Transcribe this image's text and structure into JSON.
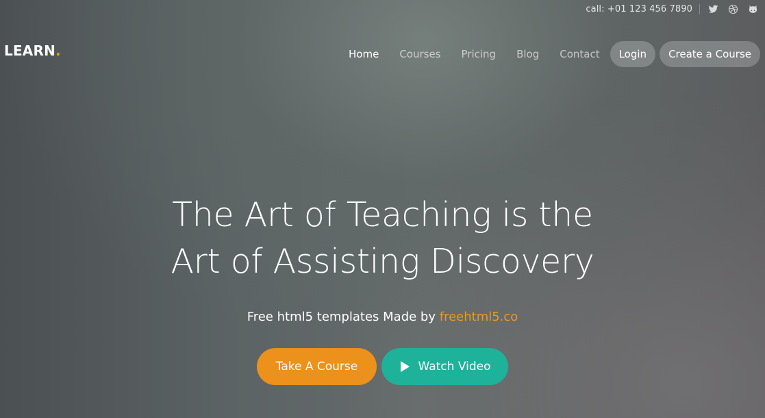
{
  "topbar": {
    "phone": "call: +01 123 456 7890",
    "social_icons": [
      "twitter-icon",
      "dribbble-icon",
      "github-icon"
    ]
  },
  "logo": {
    "text": "LEARN",
    "dot": "."
  },
  "nav": {
    "items": [
      {
        "label": "Home",
        "active": true
      },
      {
        "label": "Courses"
      },
      {
        "label": "Pricing"
      },
      {
        "label": "Blog"
      },
      {
        "label": "Contact"
      }
    ],
    "login_label": "Login",
    "create_label": "Create a Course"
  },
  "hero": {
    "headline_line1": "The Art of Teaching is the",
    "headline_line2": "Art of Assisting Discovery",
    "sub_text": "Free html5 templates Made by",
    "sub_link": "freehtml5.co",
    "primary_button": "Take A Course",
    "secondary_button": "Watch Video"
  },
  "colors": {
    "accent_orange": "#ec911b",
    "accent_teal": "#1eb29a"
  }
}
